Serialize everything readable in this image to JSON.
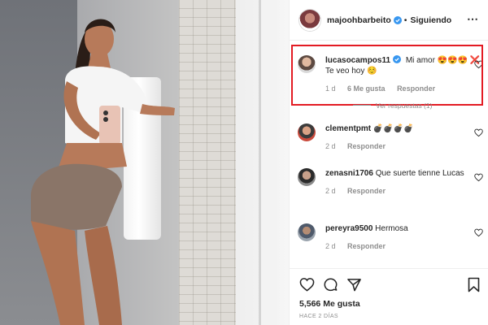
{
  "post": {
    "author": "majoohbarbeito",
    "separator": "•",
    "follow_status": "Siguiendo",
    "more_icon": "more-horizontal-icon"
  },
  "comments": [
    {
      "username": "lucasocampos11",
      "verified": true,
      "text": "Mi amor 😍😍😍 ❌ Te veo hoy ☺️",
      "age": "1 d",
      "likes": "6 Me gusta",
      "reply_label": "Responder",
      "view_replies": "Ver respuestas (1)",
      "highlighted": true
    },
    {
      "username": "clementpmt",
      "text": "💣💣💣💣",
      "age": "2 d",
      "reply_label": "Responder"
    },
    {
      "username": "zenasni1706",
      "text": "Que suerte tienne Lucas",
      "age": "2 d",
      "reply_label": "Responder"
    },
    {
      "username": "pereyra9500",
      "text": "Hermosa",
      "age": "2 d",
      "reply_label": "Responder"
    }
  ],
  "actions": {
    "likes_count": "5,566 Me gusta",
    "timestamp": "HACE 2 DÍAS"
  },
  "colors": {
    "highlight_border": "#e31b23",
    "verified_badge": "#3897f0",
    "muted_text": "#8e8e8e"
  }
}
